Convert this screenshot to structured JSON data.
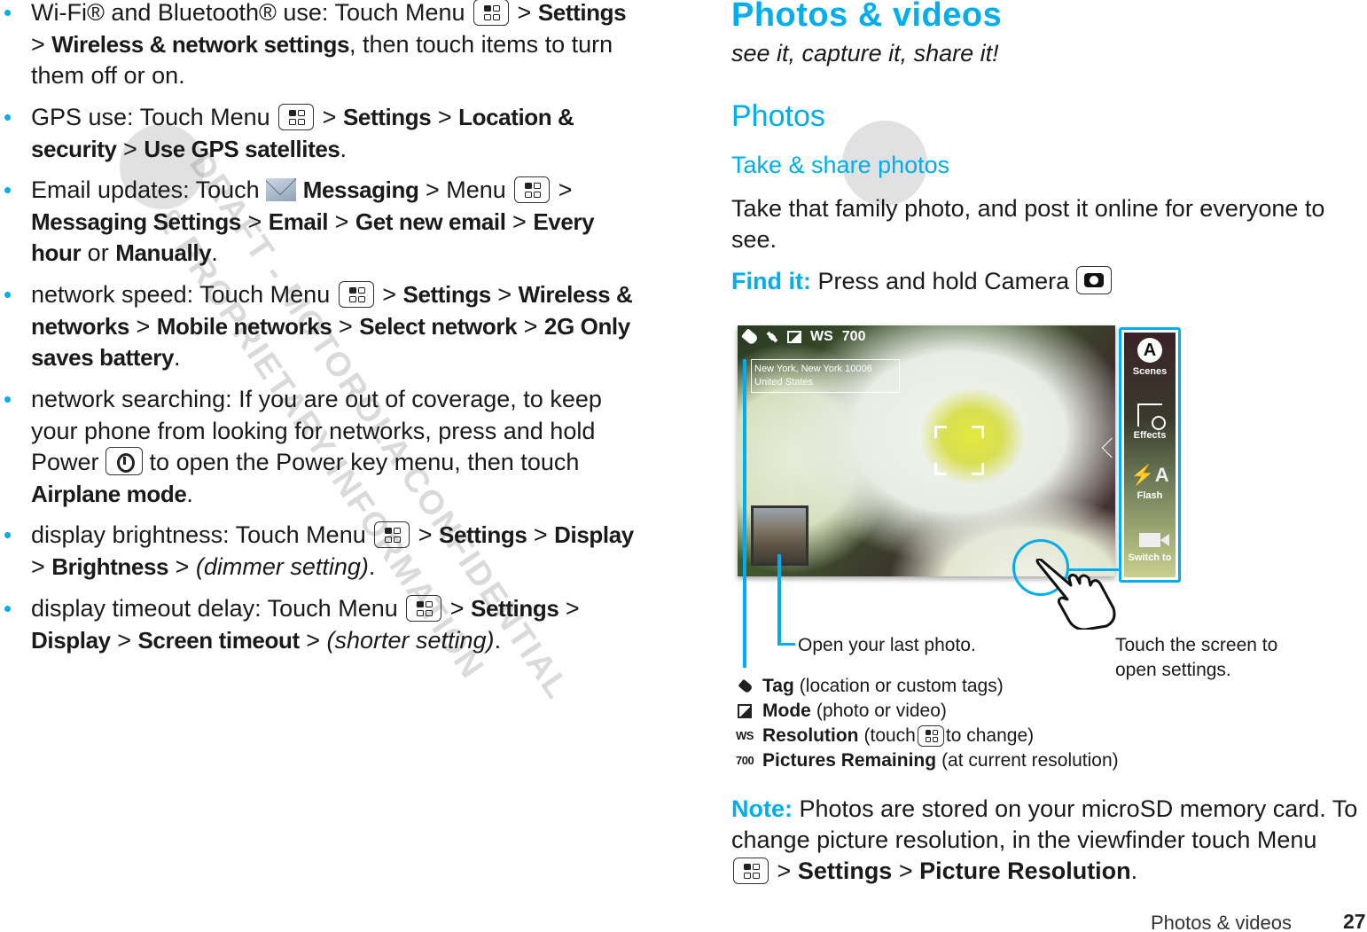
{
  "left_column": {
    "bullets": [
      {
        "parts": [
          {
            "t": "Wi-Fi® and Bluetooth® use: Touch Menu "
          },
          {
            "icon": "menu-key"
          },
          {
            "t": " > "
          },
          {
            "b": "Settings"
          },
          {
            "t": " > "
          },
          {
            "b": "Wireless & network settings"
          },
          {
            "t": ", then touch items to turn them off or on."
          }
        ]
      },
      {
        "parts": [
          {
            "t": "GPS use: Touch Menu "
          },
          {
            "icon": "menu-key"
          },
          {
            "t": " > "
          },
          {
            "b": "Settings"
          },
          {
            "t": " > "
          },
          {
            "b": "Location & security"
          },
          {
            "t": " > "
          },
          {
            "b": "Use GPS satellites"
          },
          {
            "t": "."
          }
        ]
      },
      {
        "parts": [
          {
            "t": "Email updates: Touch "
          },
          {
            "icon": "mail"
          },
          {
            "t": " "
          },
          {
            "b": "Messaging"
          },
          {
            "t": " > Menu "
          },
          {
            "icon": "menu-key"
          },
          {
            "t": " > "
          },
          {
            "b": "Messaging Settings"
          },
          {
            "t": " > "
          },
          {
            "b": "Email"
          },
          {
            "t": " > "
          },
          {
            "b": "Get new email"
          },
          {
            "t": " > "
          },
          {
            "b": "Every hour"
          },
          {
            "t": " or "
          },
          {
            "b": "Manually"
          },
          {
            "t": "."
          }
        ]
      },
      {
        "parts": [
          {
            "t": "network speed: Touch Menu "
          },
          {
            "icon": "menu-key"
          },
          {
            "t": " > "
          },
          {
            "b": "Settings"
          },
          {
            "t": " > "
          },
          {
            "b": "Wireless & networks"
          },
          {
            "t": " > "
          },
          {
            "b": "Mobile networks"
          },
          {
            "t": " > "
          },
          {
            "b": "Select network"
          },
          {
            "t": " > "
          },
          {
            "b": "2G Only saves battery"
          },
          {
            "t": "."
          }
        ]
      },
      {
        "parts": [
          {
            "t": "network searching: If you are out of coverage, to keep your phone from looking for networks, press and hold Power "
          },
          {
            "icon": "power-key"
          },
          {
            "t": " to open the Power key menu, then touch "
          },
          {
            "b": "Airplane mode"
          },
          {
            "t": "."
          }
        ]
      },
      {
        "parts": [
          {
            "t": "display brightness: Touch Menu "
          },
          {
            "icon": "menu-key"
          },
          {
            "t": " > "
          },
          {
            "b": "Settings"
          },
          {
            "t": " > "
          },
          {
            "b": "Display"
          },
          {
            "t": " > "
          },
          {
            "b": "Brightness"
          },
          {
            "t": " > "
          },
          {
            "i": "(dimmer setting)"
          },
          {
            "t": "."
          }
        ]
      },
      {
        "parts": [
          {
            "t": "display timeout delay: Touch Menu "
          },
          {
            "icon": "menu-key"
          },
          {
            "t": " > "
          },
          {
            "b": "Settings"
          },
          {
            "t": " > "
          },
          {
            "b": "Display"
          },
          {
            "t": " > "
          },
          {
            "b": "Screen timeout"
          },
          {
            "t": " > "
          },
          {
            "i": "(shorter setting)"
          },
          {
            "t": "."
          }
        ]
      }
    ]
  },
  "right_column": {
    "title": "Photos & videos",
    "subtitle": "see it, capture it, share it!",
    "section_heading": "Photos",
    "subsection_heading": "Take & share photos",
    "intro": "Take that family photo, and post it online for everyone to see.",
    "find_it_label": "Find it:",
    "find_it_text": "Press and hold Camera",
    "viewfinder": {
      "status_resolution": "WS",
      "status_remaining": "700",
      "location_line1": "New York, New York 10006",
      "location_line2": "United States",
      "side_panel": [
        {
          "icon": "scenes-icon",
          "label": "Scenes",
          "glyph": "A"
        },
        {
          "icon": "effects-icon",
          "label": "Effects"
        },
        {
          "icon": "flash-icon",
          "label": "Flash",
          "glyph": "⚡A"
        },
        {
          "icon": "video-icon",
          "label": "Switch to"
        }
      ]
    },
    "callouts": {
      "last_photo": "Open your last photo.",
      "touch_screen": "Touch the screen to open settings."
    },
    "legend": [
      {
        "icon": "tag-icon",
        "term": "Tag",
        "desc": "(location or custom tags)"
      },
      {
        "icon": "mode-icon",
        "term": "Mode",
        "desc": "(photo or video)"
      },
      {
        "icon_text": "WS",
        "term": "Resolution",
        "desc_pre": "(touch",
        "desc_post": "to change)"
      },
      {
        "icon_text": "700",
        "term": "Pictures Remaining",
        "desc": "(at current resolution)"
      }
    ],
    "note_label": "Note:",
    "note_text_1": "Photos are stored on your microSD memory card. To change picture resolution, in the viewfinder touch Menu",
    "note_sep": ">",
    "note_settings": "Settings",
    "note_picture_resolution": "Picture Resolution",
    "note_end": "."
  },
  "footer": {
    "section": "Photos & videos",
    "page_number": "27"
  },
  "watermark": {
    "line1": "DRAFT - MOTOROLA CONFIDENTIAL",
    "line2": "& PROPRIETARY INFORMATION"
  },
  "colors": {
    "accent": "#00aeef",
    "text": "#1a1a1a"
  }
}
